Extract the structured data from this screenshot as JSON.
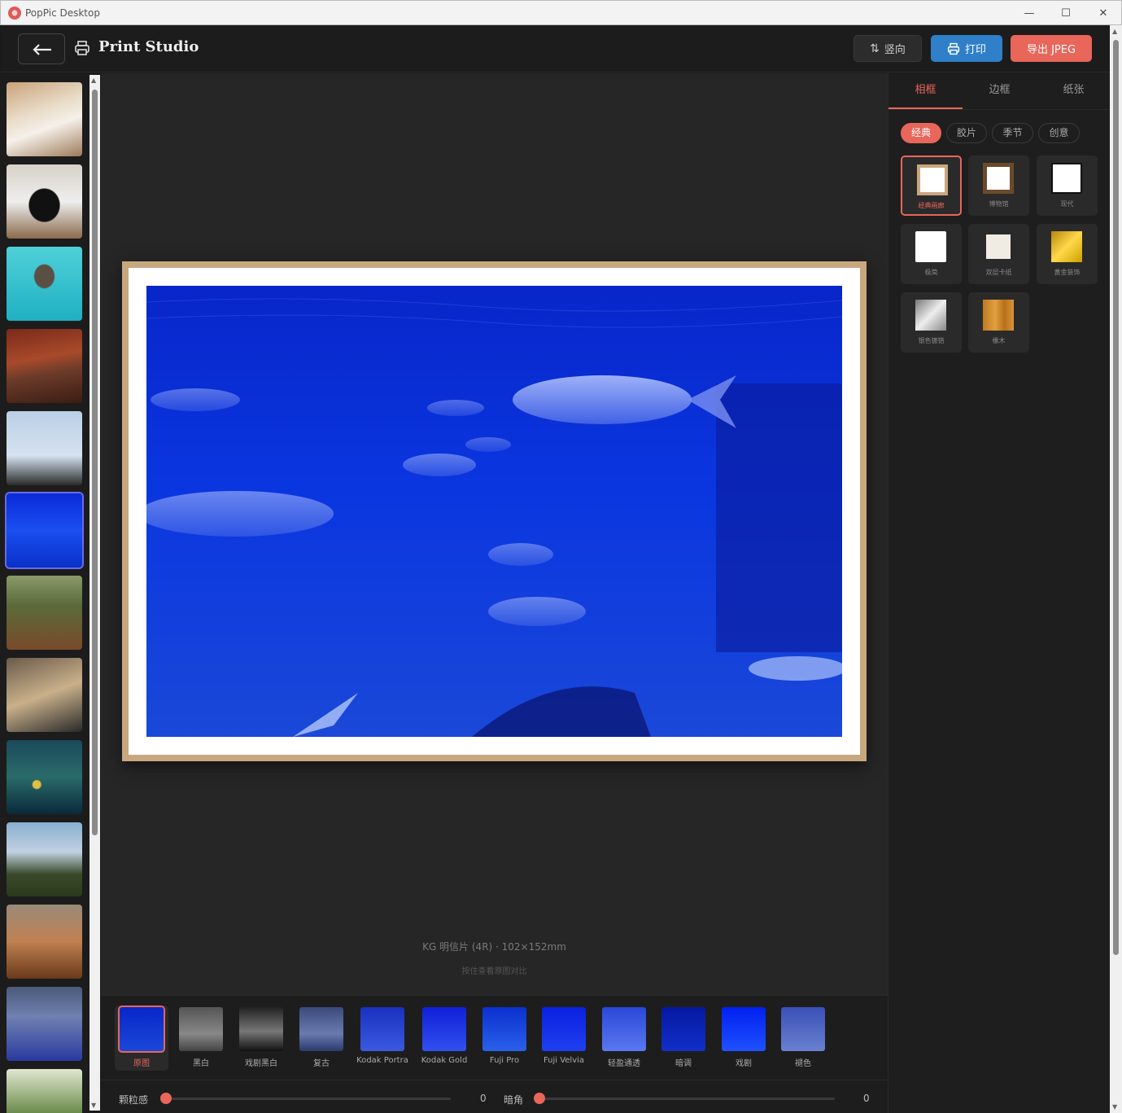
{
  "window": {
    "title": "PopPic Desktop"
  },
  "header": {
    "title": "Print Studio",
    "orientation_label": "竖向",
    "print_label": "打印",
    "export_label": "导出 JPEG"
  },
  "canvas": {
    "paper_label": "KG 明信片 (4R) · 102×152mm",
    "hint_label": "按住查看原图对比"
  },
  "filters": [
    {
      "label": "原图",
      "active": true
    },
    {
      "label": "黑白"
    },
    {
      "label": "戏剧黑白"
    },
    {
      "label": "复古"
    },
    {
      "label": "Kodak Portra"
    },
    {
      "label": "Kodak Gold"
    },
    {
      "label": "Fuji Pro"
    },
    {
      "label": "Fuji Velvia"
    },
    {
      "label": "轻盈通透"
    },
    {
      "label": "暗调"
    },
    {
      "label": "戏剧"
    },
    {
      "label": "褪色"
    }
  ],
  "sliders": {
    "grain": {
      "label": "颗粒感",
      "value": "0"
    },
    "vignette": {
      "label": "暗角",
      "value": "0"
    }
  },
  "right_panel": {
    "tabs": [
      "相框",
      "边框",
      "纸张"
    ],
    "chips": [
      "经典",
      "胶片",
      "季节",
      "创意"
    ],
    "frames": [
      {
        "name": "经典画廊",
        "active": true
      },
      {
        "name": "博物馆"
      },
      {
        "name": "现代"
      },
      {
        "name": "极简"
      },
      {
        "name": "双层卡纸"
      },
      {
        "name": "黄金装饰"
      },
      {
        "name": "银色镀铬"
      },
      {
        "name": "橡木"
      }
    ]
  },
  "colors": {
    "accent": "#e8665a",
    "print_blue": "#2f7fc9",
    "frame_tan": "#c8a77e"
  }
}
